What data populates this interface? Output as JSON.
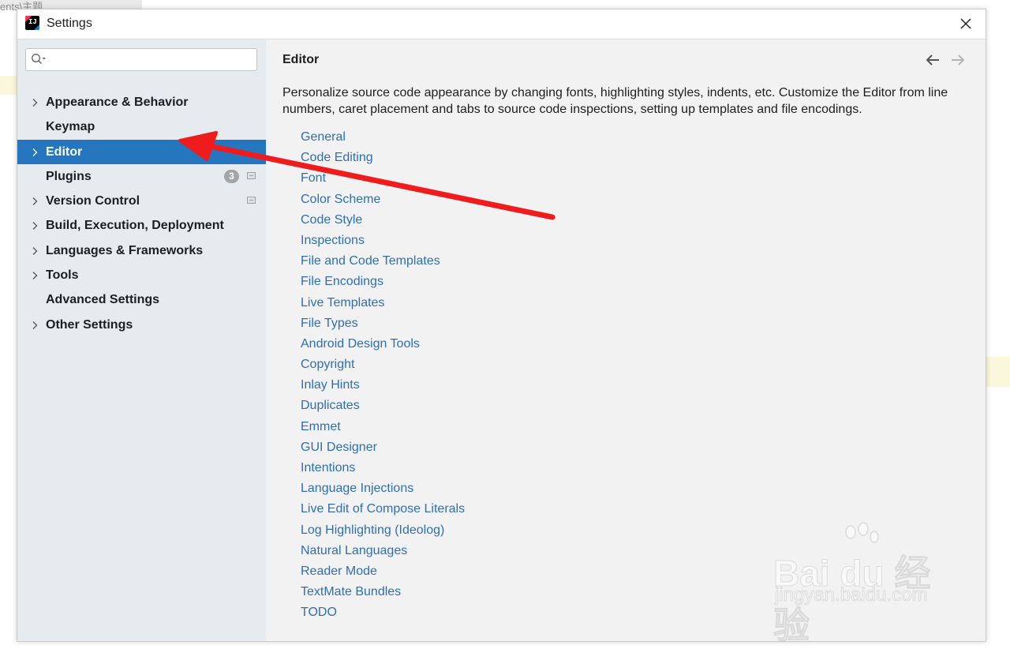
{
  "background": {
    "partial_text": "ents\\主题"
  },
  "window": {
    "title": "Settings",
    "app_icon_text": "IJ"
  },
  "search": {
    "value": "",
    "placeholder": ""
  },
  "sidebar": {
    "items": [
      {
        "label": "Appearance & Behavior",
        "expandable": true
      },
      {
        "label": "Keymap",
        "expandable": false
      },
      {
        "label": "Editor",
        "expandable": true,
        "selected": true
      },
      {
        "label": "Plugins",
        "expandable": false,
        "badge": "3"
      },
      {
        "label": "Version Control",
        "expandable": true
      },
      {
        "label": "Build, Execution, Deployment",
        "expandable": true
      },
      {
        "label": "Languages & Frameworks",
        "expandable": true
      },
      {
        "label": "Tools",
        "expandable": true
      },
      {
        "label": "Advanced Settings",
        "expandable": false
      },
      {
        "label": "Other Settings",
        "expandable": true
      }
    ]
  },
  "content": {
    "title": "Editor",
    "description": "Personalize source code appearance by changing fonts, highlighting styles, indents, etc. Customize the Editor from line numbers, caret placement and tabs to source code inspections, setting up templates and file encodings.",
    "links": [
      "General",
      "Code Editing",
      "Font",
      "Color Scheme",
      "Code Style",
      "Inspections",
      "File and Code Templates",
      "File Encodings",
      "Live Templates",
      "File Types",
      "Android Design Tools",
      "Copyright",
      "Inlay Hints",
      "Duplicates",
      "Emmet",
      "GUI Designer",
      "Intentions",
      "Language Injections",
      "Live Edit of Compose Literals",
      "Log Highlighting (Ideolog)",
      "Natural Languages",
      "Reader Mode",
      "TextMate Bundles",
      "TODO"
    ]
  },
  "colors": {
    "selection": "#2675bf",
    "link": "#2f6fb1",
    "sidebar_bg": "#e6ebf0",
    "annotation_arrow": "#ee1c1c"
  },
  "watermark": {
    "main": "Bai du 经验",
    "sub": "jingyan.baidu.com"
  }
}
